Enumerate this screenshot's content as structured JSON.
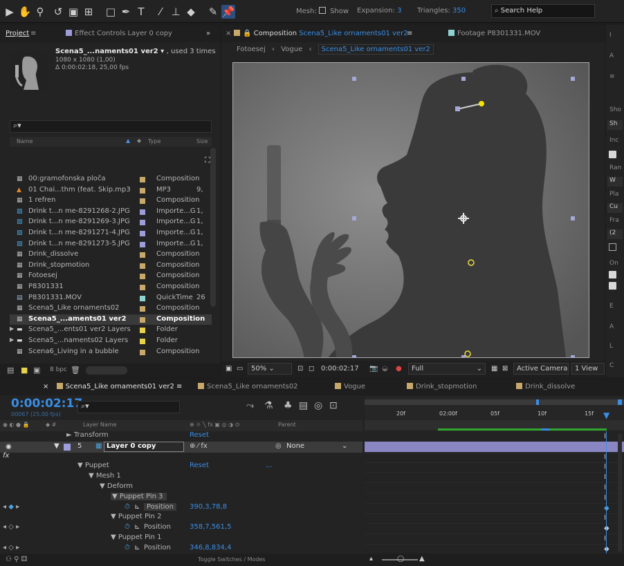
{
  "toolbar": {
    "mesh_label": "Mesh:",
    "show_label": "Show",
    "expansion_label": "Expansion:",
    "expansion_value": "3",
    "triangles_label": "Triangles:",
    "triangles_value": "350",
    "search_placeholder": "Search Help"
  },
  "project": {
    "tabs": [
      "Project",
      "Effect Controls Layer 0 copy"
    ],
    "selected_name": "Scena5_...naments01 ver2",
    "used_text": ", used 3 times",
    "resolution": "1080 x 1080 (1,00)",
    "duration": "Δ 0:00:02:18, 25,00 fps",
    "search_placeholder": "",
    "columns": {
      "name": "Name",
      "type": "Type",
      "size": "Size"
    },
    "items": [
      {
        "name": "00:gramofonska ploča",
        "type": "Composition",
        "size": "",
        "icon": "comp",
        "color": "#c8a96a"
      },
      {
        "name": "01 Chai...thm (feat. Skip.mp3",
        "type": "MP3",
        "size": "9,",
        "icon": "audio",
        "color": "#c8a96a"
      },
      {
        "name": "1 refren",
        "type": "Composition",
        "size": "",
        "icon": "comp",
        "color": "#c8a96a"
      },
      {
        "name": "Drink t...n me-8291268-2.JPG",
        "type": "Importe...G",
        "size": "1,",
        "icon": "image",
        "color": "#9d9ddb"
      },
      {
        "name": "Drink t...n me-8291269-3.JPG",
        "type": "Importe...G",
        "size": "1,",
        "icon": "image",
        "color": "#9d9ddb"
      },
      {
        "name": "Drink t...n me-8291271-4.JPG",
        "type": "Importe...G",
        "size": "1,",
        "icon": "image",
        "color": "#9d9ddb"
      },
      {
        "name": "Drink t...n me-8291273-5.JPG",
        "type": "Importe...G",
        "size": "1,",
        "icon": "image",
        "color": "#9d9ddb"
      },
      {
        "name": "Drink_dissolve",
        "type": "Composition",
        "size": "",
        "icon": "comp",
        "color": "#c8a96a"
      },
      {
        "name": "Drink_stopmotion",
        "type": "Composition",
        "size": "",
        "icon": "comp",
        "color": "#c8a96a"
      },
      {
        "name": "Fotoesej",
        "type": "Composition",
        "size": "",
        "icon": "comp",
        "color": "#c8a96a"
      },
      {
        "name": "P8301331",
        "type": "Composition",
        "size": "",
        "icon": "comp",
        "color": "#c8a96a"
      },
      {
        "name": "P8301331.MOV",
        "type": "QuickTime",
        "size": "26",
        "icon": "file",
        "color": "#8fd2d2"
      },
      {
        "name": "Scena5_Like ornaments02",
        "type": "Composition",
        "size": "",
        "icon": "comp",
        "color": "#c8a96a"
      },
      {
        "name": "Scena5_...aments01 ver2",
        "type": "Composition",
        "size": "",
        "icon": "comp",
        "color": "#c8a96a",
        "selected": true
      },
      {
        "name": "Scena5_...ents01 ver2 Layers",
        "type": "Folder",
        "size": "",
        "icon": "folder",
        "color": "#e8d24a"
      },
      {
        "name": "Scena5_...naments02 Layers",
        "type": "Folder",
        "size": "",
        "icon": "folder",
        "color": "#e8d24a"
      },
      {
        "name": "Scena6_Living in a bubble",
        "type": "Composition",
        "size": "",
        "icon": "comp",
        "color": "#c8a96a"
      }
    ],
    "bpc": "8 bpc"
  },
  "comp": {
    "tab_prefix": "Composition",
    "tab_name": "Scena5_Like ornaments01 ver2",
    "footage_tab": "Footage P8301331.MOV",
    "breadcrumb": [
      "Fotoesej",
      "Vogue",
      "Scena5_Like ornaments01 ver2"
    ],
    "zoom": "50%",
    "timecode": "0:00:02:17",
    "resolution": "Full",
    "camera": "Active Camera",
    "views": "1 View"
  },
  "right_panel": {
    "labels": [
      "I",
      "A",
      "≡",
      "Sho",
      "Sh",
      "Inc",
      "Ran",
      "W",
      "Pla",
      "Cu",
      "Fra",
      "(2",
      "On",
      "E",
      "A",
      "L",
      "C"
    ]
  },
  "timeline": {
    "tabs": [
      "Scena5_Like ornaments01 ver2",
      "Scena5_Like ornaments02",
      "Vogue",
      "Drink_stopmotion",
      "Drink_dissolve"
    ],
    "tab_colors": [
      "#c8a96a",
      "#c8a96a",
      "#c8a96a",
      "#c8a96a",
      "#c8a96a"
    ],
    "current_time": "0:00:02:17",
    "frame_info": "00067 (25.00 fps)",
    "ruler_labels": [
      "20f",
      "02:00f",
      "05f",
      "10f",
      "15f"
    ],
    "columns": {
      "layer_name": "Layer Name",
      "parent": "Parent"
    },
    "rows": [
      {
        "indent": 96,
        "name": "► Transform",
        "value": "Reset",
        "kind": "prop"
      },
      {
        "indent": 0,
        "name": "Layer 0 copy",
        "value": "",
        "kind": "layer",
        "number": "5",
        "parent": "None"
      },
      {
        "indent": 4,
        "name": "fx",
        "value": "",
        "kind": "fx"
      },
      {
        "indent": 112,
        "name": "▼ Puppet",
        "value": "Reset",
        "extra": "...",
        "kind": "prop"
      },
      {
        "indent": 128,
        "name": "▼ Mesh 1",
        "value": "",
        "kind": "prop"
      },
      {
        "indent": 144,
        "name": "▼ Deform",
        "value": "",
        "kind": "prop"
      },
      {
        "indent": 160,
        "name": "▼ Puppet Pin 3",
        "value": "",
        "kind": "pin"
      },
      {
        "indent": 190,
        "name": "Position",
        "value": "390,3,78,8",
        "kind": "position",
        "active": true
      },
      {
        "indent": 160,
        "name": "▼ Puppet Pin 2",
        "value": "",
        "kind": "pin"
      },
      {
        "indent": 190,
        "name": "Position",
        "value": "358,7,561,5",
        "kind": "position"
      },
      {
        "indent": 160,
        "name": "▼ Puppet Pin 1",
        "value": "",
        "kind": "pin"
      },
      {
        "indent": 190,
        "name": "Position",
        "value": "346,8,834,4",
        "kind": "position"
      }
    ],
    "footer_label": "Toggle Switches / Modes"
  }
}
